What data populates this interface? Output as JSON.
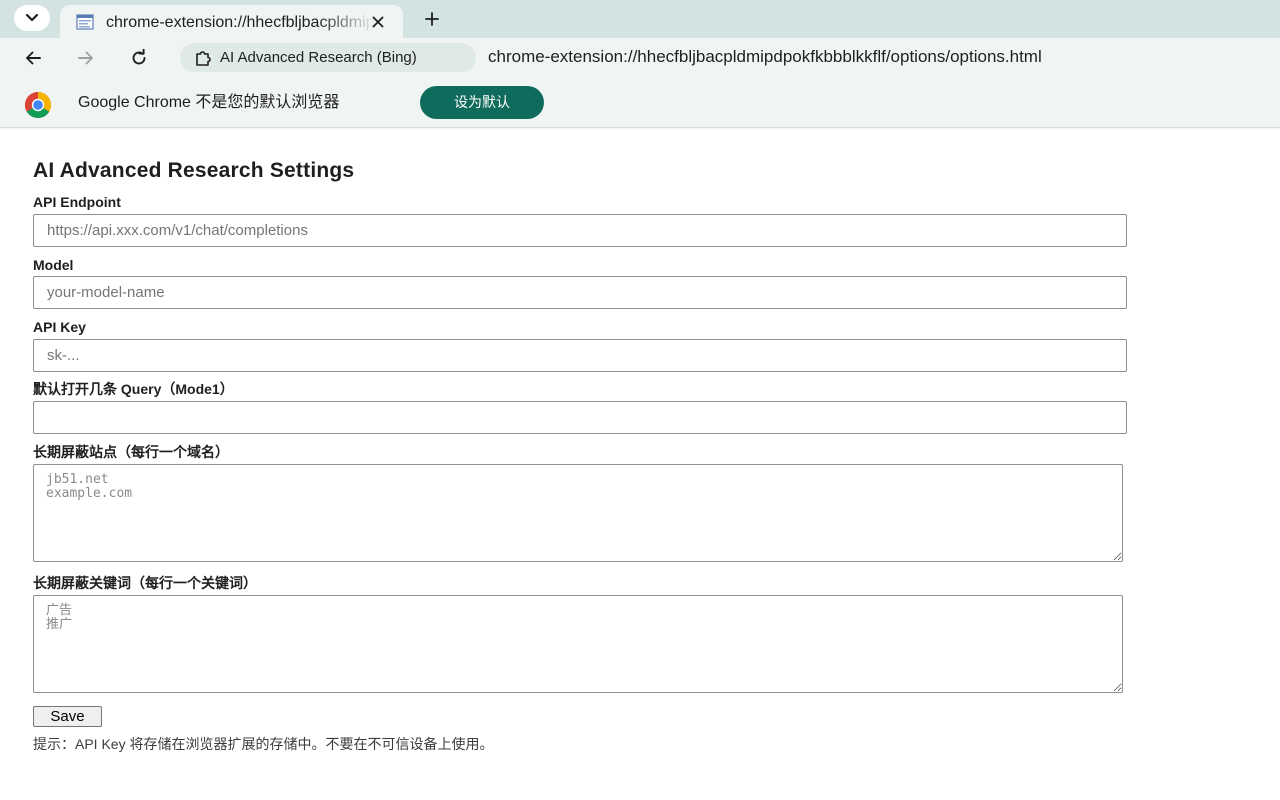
{
  "browser": {
    "tab": {
      "title": "chrome-extension://hhecfbljbacpldmipdpokfkbbblkkflf/options/options.html"
    },
    "omnibox": {
      "chip_label": "AI Advanced Research (Bing)",
      "url": "chrome-extension://hhecfbljbacpldmipdpokfkbbblkkflf/options/options.html"
    },
    "infobar": {
      "message": "Google Chrome 不是您的默认浏览器",
      "button_label": "设为默认"
    },
    "icons": {
      "tab_search": "chevron-down-icon",
      "tab_favicon": "extension-page-icon",
      "tab_close": "close-icon",
      "new_tab": "plus-icon",
      "back": "arrow-left-icon",
      "forward": "arrow-right-icon",
      "reload": "reload-icon",
      "chip": "puzzle-piece-icon",
      "infobar": "chrome-logo-icon"
    },
    "accent_color": "#0f6b5c"
  },
  "page": {
    "title": "AI Advanced Research Settings",
    "fields": {
      "api_endpoint": {
        "label": "API Endpoint",
        "value": "",
        "placeholder": "https://api.xxx.com/v1/chat/completions"
      },
      "model": {
        "label": "Model",
        "value": "",
        "placeholder": "your-model-name"
      },
      "api_key": {
        "label": "API Key",
        "value": "",
        "placeholder": "sk-..."
      },
      "query_count": {
        "label": "默认打开几条 Query（Mode1）",
        "value": "",
        "placeholder": ""
      },
      "blocked_sites": {
        "label": "长期屏蔽站点（每行一个域名）",
        "value": "",
        "placeholder": "jb51.net\nexample.com"
      },
      "blocked_keywords": {
        "label": "长期屏蔽关键词（每行一个关键词）",
        "value": "",
        "placeholder": "广告\n推广"
      }
    },
    "save_label": "Save",
    "hint": "提示：API Key 将存储在浏览器扩展的存储中。不要在不可信设备上使用。"
  }
}
